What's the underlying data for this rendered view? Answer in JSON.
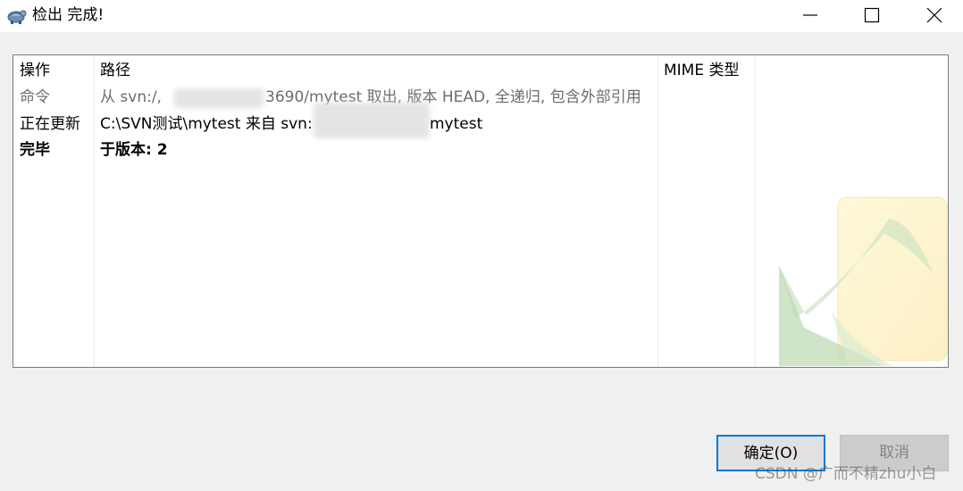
{
  "window": {
    "title": "检出 完成!",
    "icons": {
      "app": "tortoise-icon",
      "minimize": "minimize-icon",
      "maximize": "maximize-icon",
      "close": "close-icon"
    }
  },
  "list": {
    "headers": {
      "action": "操作",
      "path": "路径",
      "mime": "MIME 类型"
    },
    "rows": [
      {
        "action": "命令",
        "path_prefix": "从 svn:/,",
        "path_suffix": "3690/mytest 取出, 版本 HEAD, 全递归, 包含外部引用",
        "style": "gray"
      },
      {
        "action": "正在更新",
        "path_prefix": "C:\\SVN测试\\mytest 来自 svn:",
        "path_suffix": "mytest",
        "style": "normal"
      },
      {
        "action": "完毕",
        "path": "于版本: 2",
        "style": "bold"
      }
    ]
  },
  "buttons": {
    "ok": "确定(O)",
    "cancel": "取消"
  },
  "watermark_credit": "CSDN @广而不精zhu小白",
  "colors": {
    "ok_border": "#0078d7",
    "command_text": "#6d6d6d"
  }
}
